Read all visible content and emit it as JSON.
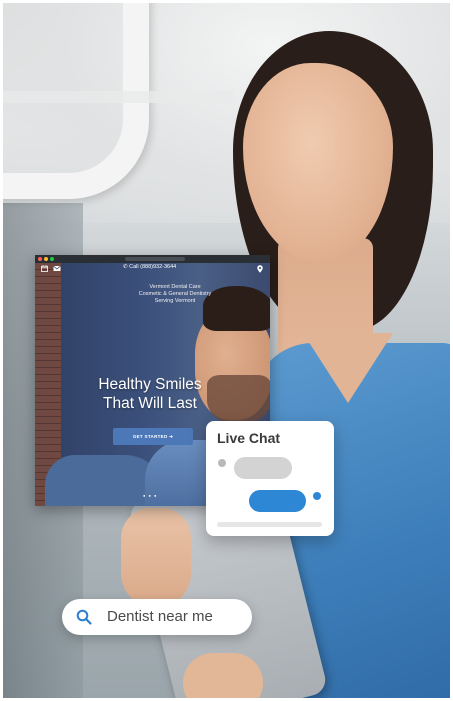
{
  "browser": {
    "phone": "Call (888)932-3644",
    "tagline": [
      "Vermont Dental Care",
      "Cosmetic & General Dentistry",
      "Serving Vermont"
    ],
    "headline": [
      "Healthy Smiles",
      "That Will Last"
    ],
    "cta_label": "GET STARTED",
    "icons": [
      "calendar-icon",
      "mail-icon",
      "phone-icon",
      "location-pin-icon"
    ]
  },
  "chat": {
    "title": "Live Chat"
  },
  "search": {
    "query": "Dentist near me"
  },
  "colors": {
    "accent_blue": "#2d87d4",
    "cta_blue": "#4c78b8",
    "scrubs_blue": "#3e7fbb"
  }
}
